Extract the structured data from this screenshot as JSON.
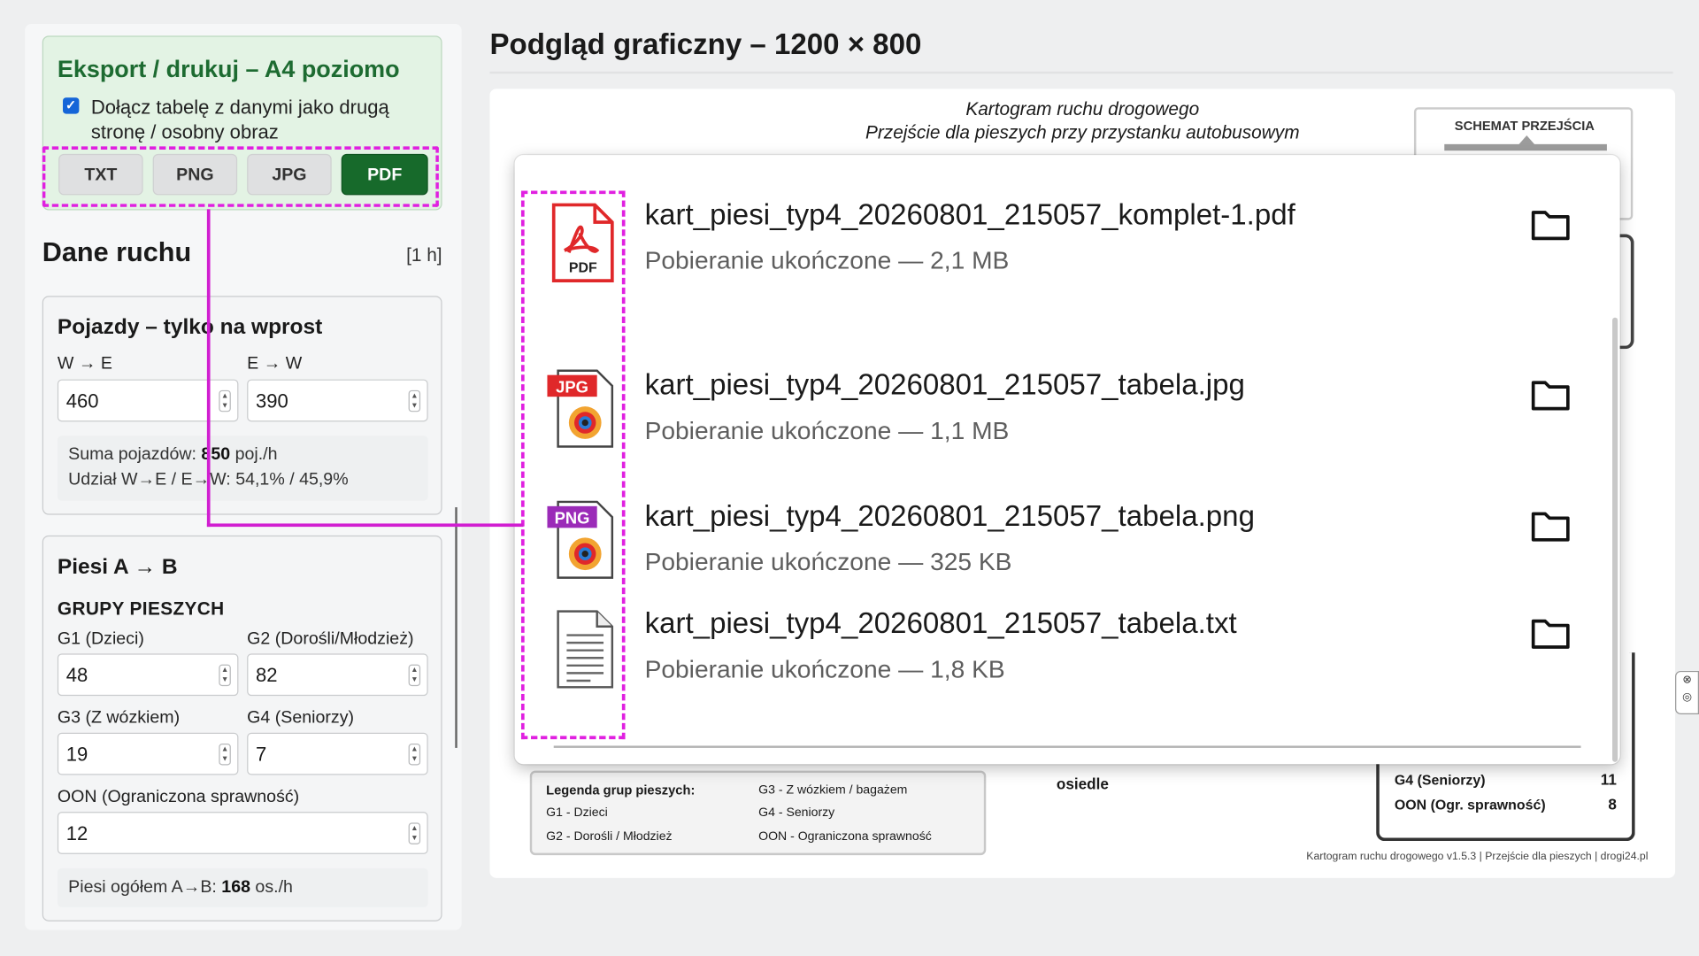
{
  "export": {
    "title": "Eksport / drukuj – A4 poziomo",
    "checkbox_checked": true,
    "checkbox_label": "Dołącz tabelę z danymi jako drugą stronę / osobny obraz",
    "formats": [
      "TXT",
      "PNG",
      "JPG",
      "PDF"
    ],
    "active_format": "PDF"
  },
  "traffic": {
    "title": "Dane ruchu",
    "unit": "[1 h]",
    "vehicles": {
      "title": "Pojazdy – tylko na wprost",
      "we_label": "W → E",
      "ew_label": "E → W",
      "we_value": "460",
      "ew_value": "390",
      "sum_prefix": "Suma pojazdów: ",
      "sum_value": "850",
      "sum_suffix": " poj./h",
      "share": "Udział W→E / E→W: 54,1% / 45,9%"
    },
    "pedestrians": {
      "title": "Piesi A → B",
      "groups_heading": "GRUPY PIESZYCH",
      "g1_label": "G1 (Dzieci)",
      "g1_value": "48",
      "g2_label": "G2 (Dorośli/Młodzież)",
      "g2_value": "82",
      "g3_label": "G3 (Z wózkiem)",
      "g3_value": "19",
      "g4_label": "G4 (Seniorzy)",
      "g4_value": "7",
      "oon_label": "OON (Ograniczona sprawność)",
      "oon_value": "12",
      "total_prefix": "Piesi ogółem A→B: ",
      "total_value": "168",
      "total_suffix": " os./h"
    }
  },
  "preview": {
    "title": "Podgląd graficzny – 1200 × 800",
    "map_title_1": "Kartogram ruchu drogowego",
    "map_title_2": "Przejście dla pieszych przy przystanku autobusowym",
    "schema_label": "SCHEMAT PRZEJŚCIA",
    "right_rows": [
      {
        "label": "G4 (Seniorzy)",
        "value": "11"
      },
      {
        "label": "OON (Ogr. sprawność)",
        "value": "8"
      }
    ],
    "legend": {
      "title": "Legenda grup pieszych:",
      "g1": "G1 - Dzieci",
      "g2": "G2 - Dorośli / Młodzież",
      "g3": "G3 - Z wózkiem / bagażem",
      "g4": "G4 - Seniorzy",
      "oon": "OON - Ograniczona sprawność"
    },
    "osiedle": "osiedle",
    "footer": "Kartogram ruchu drogowego v1.5.3 | Przejście dla pieszych | drogi24.pl"
  },
  "downloads": [
    {
      "icon": "pdf-file-icon",
      "name": "kart_piesi_typ4_20260801_215057_komplet-1.pdf",
      "status": "Pobieranie ukończone — 2,1 MB"
    },
    {
      "icon": "jpg-file-icon",
      "name": "kart_piesi_typ4_20260801_215057_tabela.jpg",
      "status": "Pobieranie ukończone — 1,1 MB"
    },
    {
      "icon": "png-file-icon",
      "name": "kart_piesi_typ4_20260801_215057_tabela.png",
      "status": "Pobieranie ukończone — 325 KB"
    },
    {
      "icon": "txt-file-icon",
      "name": "kart_piesi_typ4_20260801_215057_tabela.txt",
      "status": "Pobieranie ukończone — 1,8 KB"
    }
  ],
  "colors": {
    "accent_green": "#176a2b",
    "highlight_magenta": "#e020e0",
    "pdf_red": "#e0282a",
    "jpg_red": "#e0282a",
    "png_purple": "#9b2bb8"
  }
}
